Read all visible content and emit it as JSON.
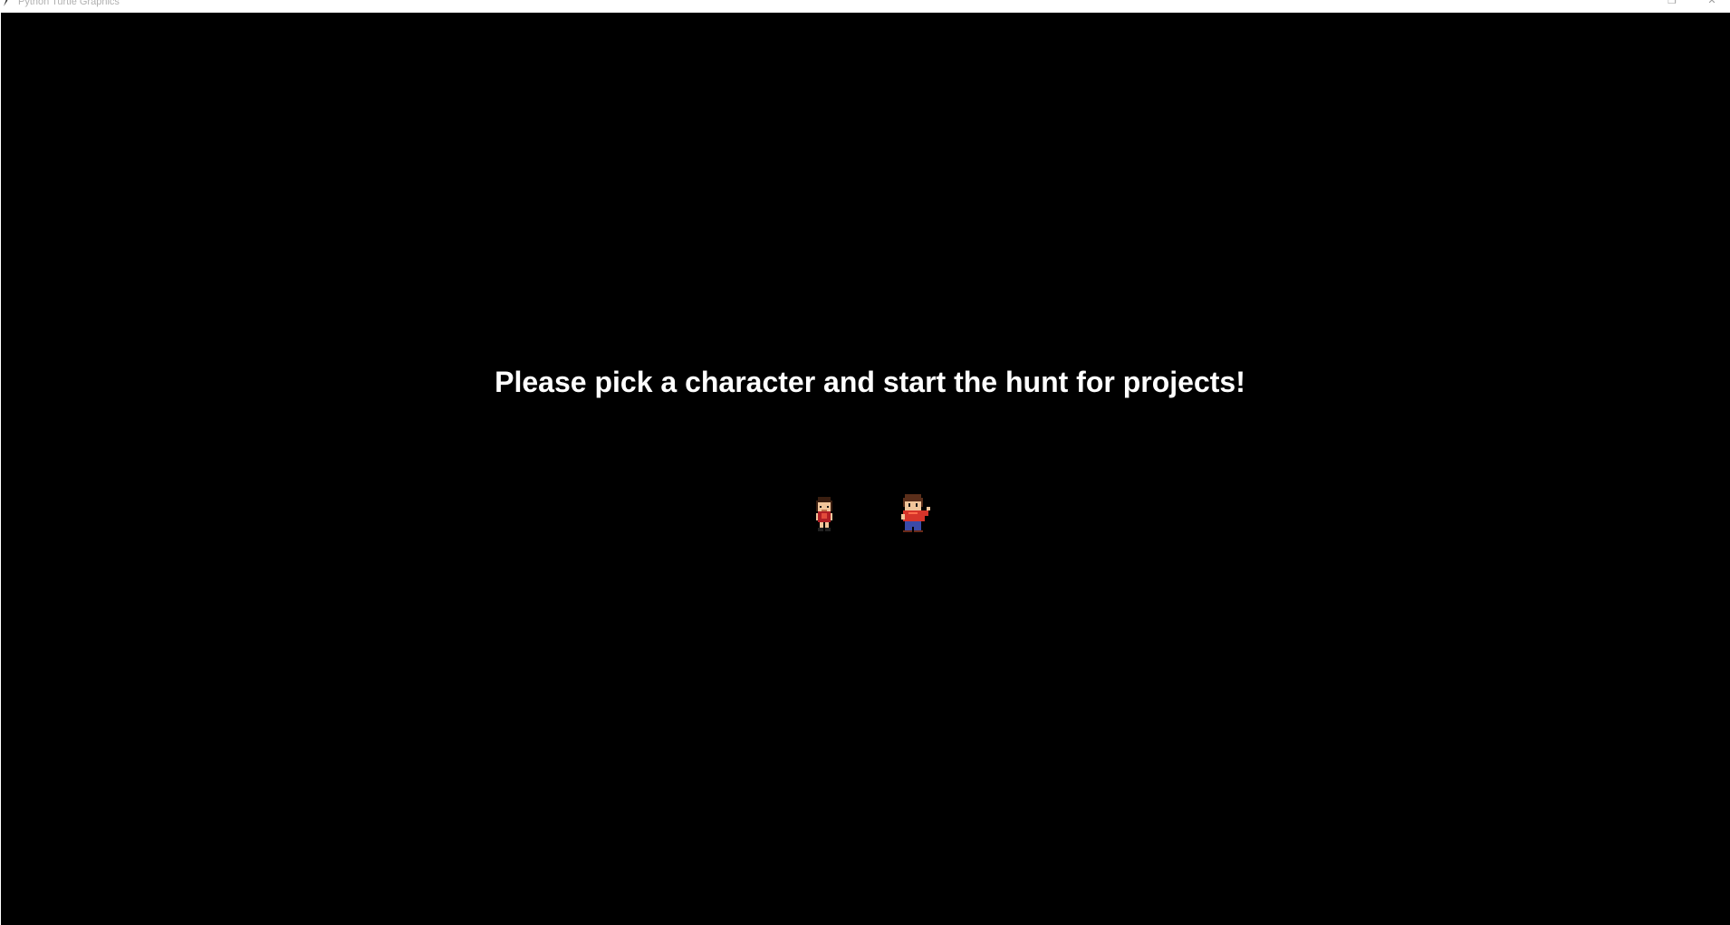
{
  "window": {
    "title": "Python Turtle Graphics",
    "restore_glyph": "❐",
    "close_glyph": "✕"
  },
  "canvas": {
    "background": "#000000",
    "prompt": "Please pick a character and start the hunt for projects!"
  },
  "characters": [
    {
      "name": "girl",
      "icon": "girl-character-sprite"
    },
    {
      "name": "boy",
      "icon": "boy-character-sprite"
    }
  ],
  "colors": {
    "text": "#ffffff",
    "shirt_red": "#d6342a",
    "hair_brown": "#5a2e1a",
    "pants_blue": "#3a4aa8",
    "skin": "#f1c59a"
  }
}
